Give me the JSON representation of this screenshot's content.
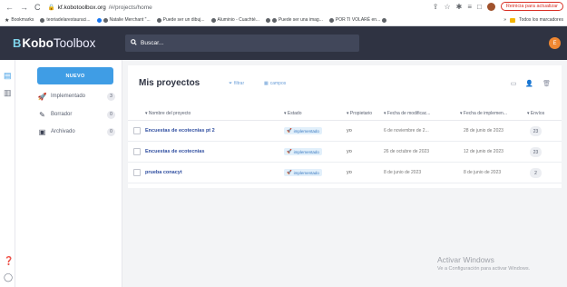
{
  "browser": {
    "url_host": "kf.kobotoolbox.org",
    "url_path": "/#/projects/home",
    "update_button": "Reinicia para actualizar",
    "bookmarks": [
      "Bookmarks",
      "teoriadelarestauraci...",
      "Natalie Merchant \"...",
      "Puede ser un dibuj...",
      "Aluminio - Cuachté...",
      "Puede ser una imag...",
      "POR TI VOLARÉ en..."
    ],
    "bookmarks_right": "Todos los marcadores"
  },
  "header": {
    "logo_mark": "B",
    "logo_kobo": "Kobo",
    "logo_toolbox": "Toolbox",
    "search_placeholder": "Buscar...",
    "avatar_initial": "E"
  },
  "sidebar": {
    "new_button": "NUEVO",
    "items": [
      {
        "label": "Implementado",
        "count": "3",
        "icon": "rocket-icon"
      },
      {
        "label": "Borrador",
        "count": "0",
        "icon": "draft-icon"
      },
      {
        "label": "Archivado",
        "count": "0",
        "icon": "archive-icon"
      }
    ]
  },
  "main": {
    "title": "Mis proyectos",
    "filter_label": "filtrar",
    "fields_label": "campos",
    "columns": {
      "name": "Nombre del proyecto",
      "status": "Estado",
      "owner": "Propietario",
      "modified": "Fecha de modificac...",
      "deployed": "Fecha de implemen...",
      "submissions": "Envíos"
    },
    "rows": [
      {
        "name": "Encuestas de ecotecnias pt 2",
        "status": "implementado",
        "owner": "yo",
        "modified": "6 de noviembre de 2...",
        "deployed": "28 de junio de 2023",
        "submissions": "23"
      },
      {
        "name": "Encuestas de ecotecnias",
        "status": "implementado",
        "owner": "yo",
        "modified": "26 de octubre de 2023",
        "deployed": "12 de junio de 2023",
        "submissions": "23"
      },
      {
        "name": "prueba conacyt",
        "status": "implementado",
        "owner": "yo",
        "modified": "8 de junio de 2023",
        "deployed": "8 de junio de 2023",
        "submissions": "2"
      }
    ]
  },
  "watermark": {
    "line1": "Activar Windows",
    "line2": "Ve a Configuración para activar Windows."
  }
}
